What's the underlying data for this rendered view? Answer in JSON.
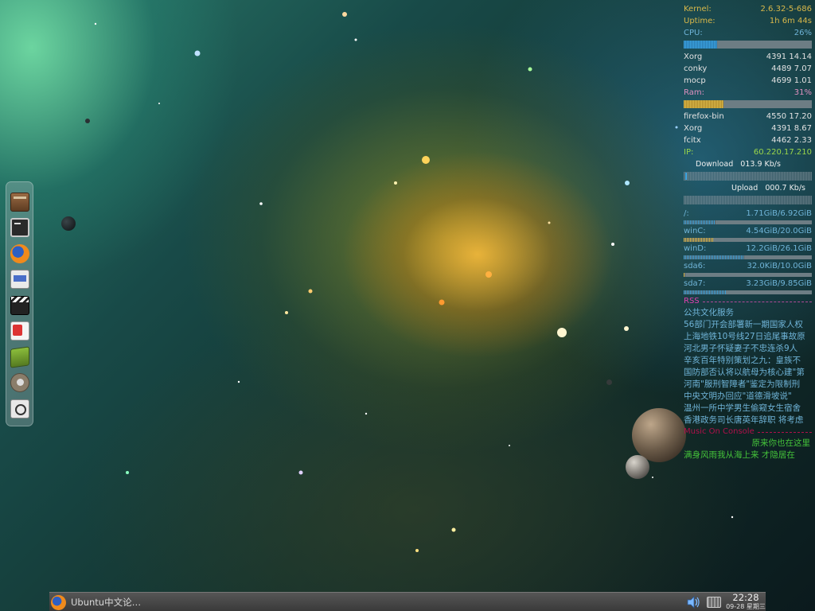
{
  "conky": {
    "kernel_label": "Kernel:",
    "kernel_value": "2.6.32-5-686",
    "uptime_label": "Uptime:",
    "uptime_value": "1h 6m 44s",
    "cpu_label": "CPU:",
    "cpu_value": "26%",
    "cpu_fraction": 0.26,
    "cpu_procs": [
      {
        "name": "Xorg",
        "pid": "4391",
        "val": "14.14"
      },
      {
        "name": "conky",
        "pid": "4489",
        "val": "7.07"
      },
      {
        "name": "mocp",
        "pid": "4699",
        "val": "1.01"
      }
    ],
    "ram_label": "Ram:",
    "ram_value": "31%",
    "ram_fraction": 0.31,
    "ram_procs": [
      {
        "name": "firefox-bin",
        "pid": "4550",
        "val": "17.20"
      },
      {
        "name": "Xorg",
        "pid": "4391",
        "val": "8.67"
      },
      {
        "name": "fcitx",
        "pid": "4462",
        "val": "2.33"
      }
    ],
    "ip_label": "IP:",
    "ip_value": "60.220.17.210",
    "download_label": "Download",
    "download_value": "013.9 Kb/s",
    "upload_label": "Upload",
    "upload_value": "000.7 Kb/s",
    "disks": [
      {
        "name": "/:",
        "used": "1.71GiB",
        "total": "6.92GiB",
        "fraction": 0.25,
        "color": "#3b9fd6"
      },
      {
        "name": "winC:",
        "used": "4.54GiB",
        "total": "20.0GiB",
        "fraction": 0.23,
        "color": "#d8b84a"
      },
      {
        "name": "winD:",
        "used": "12.2GiB",
        "total": "26.1GiB",
        "fraction": 0.47,
        "color": "#3b9fd6"
      },
      {
        "name": "sda6:",
        "used": "32.0KiB",
        "total": "10.0GiB",
        "fraction": 0.01,
        "color": "#d8b84a"
      },
      {
        "name": "sda7:",
        "used": "3.23GiB",
        "total": "9.85GiB",
        "fraction": 0.33,
        "color": "#3b9fd6"
      }
    ],
    "rss_label": "RSS",
    "rss_items": [
      "公共文化服务",
      "56部门开会部署新一期国家人权",
      "上海地铁10号线27日追尾事故原",
      "河北男子怀疑妻子不忠连杀9人",
      "辛亥百年特别策划之九：皇族不",
      "国防部否认将以航母为核心建\"第",
      "河南\"服刑智障者\"鉴定为限制刑",
      "中央文明办回应\"道德滑坡说\"",
      "温州一所中学男生偷窥女生宿舍",
      "香港政务司长唐英年辞职 将考虑"
    ],
    "moc_label": "Music On Console",
    "moc_line1": "原来你也在这里",
    "moc_line2": "满身风雨我从海上来  才隐居在"
  },
  "dock": {
    "items": [
      {
        "name": "archive-manager-icon"
      },
      {
        "name": "terminal-icon"
      },
      {
        "name": "firefox-icon"
      },
      {
        "name": "media-player-icon"
      },
      {
        "name": "video-editor-icon"
      },
      {
        "name": "text-editor-icon"
      },
      {
        "name": "dictionary-book-icon"
      },
      {
        "name": "gimp-icon"
      },
      {
        "name": "image-viewer-icon"
      }
    ]
  },
  "taskbar": {
    "task_label": "Ubuntu中文论…",
    "clock_time": "22:28",
    "clock_date": "09-28 星期三"
  },
  "colors": {
    "conky_text": "#e2e2e2",
    "conky_gold": "#d8b84a",
    "conky_cyan": "#6fb4d8",
    "conky_pink": "#e090c0",
    "conky_green": "#9ad64a",
    "rss_head": "#e040b0",
    "moc_head": "#b0104a",
    "moc_text": "#44c23a"
  }
}
